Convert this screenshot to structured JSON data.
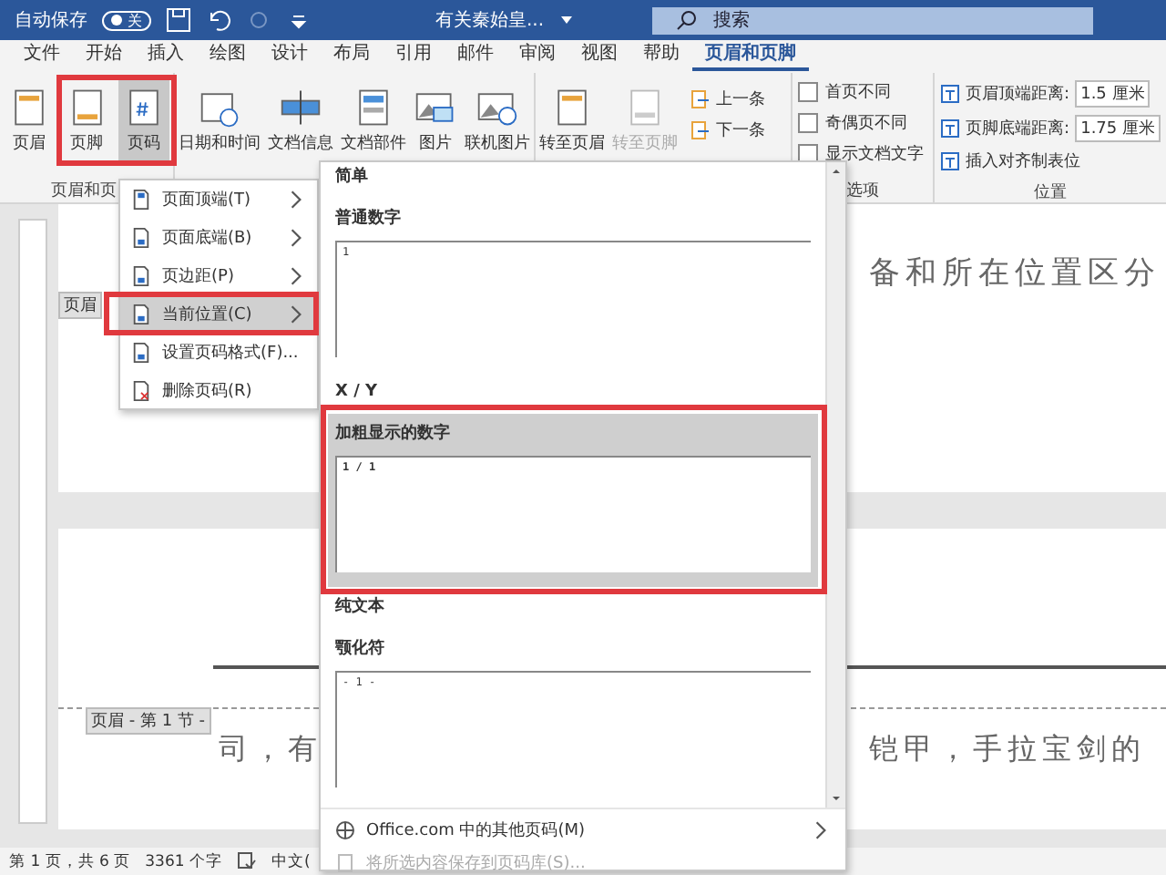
{
  "title_bar": {
    "autosave_label": "自动保存",
    "autosave_toggle": {
      "on": false,
      "label": "关"
    },
    "document_title": "有关秦始皇...",
    "search": {
      "placeholder": "搜索"
    }
  },
  "ribbon_tabs": [
    {
      "label": "文件",
      "selected": false
    },
    {
      "label": "开始",
      "selected": false
    },
    {
      "label": "插入",
      "selected": false
    },
    {
      "label": "绘图",
      "selected": false
    },
    {
      "label": "设计",
      "selected": false
    },
    {
      "label": "布局",
      "selected": false
    },
    {
      "label": "引用",
      "selected": false
    },
    {
      "label": "邮件",
      "selected": false
    },
    {
      "label": "审阅",
      "selected": false
    },
    {
      "label": "视图",
      "selected": false
    },
    {
      "label": "帮助",
      "selected": false
    },
    {
      "label": "页眉和页脚",
      "selected": true
    }
  ],
  "ribbon": {
    "header_footer_buttons": [
      {
        "label": "页眉",
        "kind": "header",
        "selected": false
      },
      {
        "label": "页脚",
        "kind": "footer",
        "selected": false
      },
      {
        "label": "页码",
        "kind": "page-number",
        "selected": true
      }
    ],
    "insert_buttons": [
      {
        "label": "日期和时间",
        "kind": "calendar"
      },
      {
        "label": "文档信息",
        "kind": "doc-info"
      },
      {
        "label": "文档部件",
        "kind": "doc-parts"
      },
      {
        "label": "图片",
        "kind": "picture"
      },
      {
        "label": "联机图片",
        "kind": "online-picture"
      }
    ],
    "navigation_buttons": [
      {
        "label": "转至页眉",
        "disabled": false
      },
      {
        "label": "转至页脚",
        "disabled": true
      }
    ],
    "small_nav": [
      {
        "label": "上一条"
      },
      {
        "label": "下一条"
      }
    ],
    "options": [
      {
        "label": "首页不同",
        "checked": false
      },
      {
        "label": "奇偶页不同",
        "checked": false
      },
      {
        "label": "显示文档文字",
        "checked": false
      }
    ],
    "position": [
      {
        "label": "页眉顶端距离:",
        "value": "1.5 厘米"
      },
      {
        "label": "页脚底端距离:",
        "value": "1.75 厘米"
      },
      {
        "label": "插入对齐制表位"
      }
    ],
    "group_labels": [
      "页眉和页",
      "选项",
      "位置"
    ]
  },
  "page_number_menu": [
    {
      "label": "页面顶端(T)",
      "submenu": true,
      "selected": false
    },
    {
      "label": "页面底端(B)",
      "submenu": true,
      "selected": false
    },
    {
      "label": "页边距(P)",
      "submenu": true,
      "selected": false
    },
    {
      "label": "当前位置(C)",
      "submenu": true,
      "selected": true
    },
    {
      "label": "设置页码格式(F)...",
      "submenu": false,
      "selected": false
    },
    {
      "label": "删除页码(R)",
      "submenu": false,
      "selected": false
    }
  ],
  "gallery": {
    "sections": [
      {
        "heading": "简单",
        "items": [
          {
            "label": "普通数字",
            "preview": "1",
            "selected": false
          }
        ]
      },
      {
        "heading": "X / Y",
        "items": [
          {
            "label": "加粗显示的数字",
            "preview": "1 / 1",
            "selected": true
          }
        ]
      },
      {
        "heading": "纯文本",
        "items": [
          {
            "label": "颚化符",
            "preview": "- 1 -",
            "selected": false
          }
        ]
      }
    ],
    "footer": [
      {
        "label": "Office.com 中的其他页码(M)",
        "disabled": false,
        "submenu": true
      },
      {
        "label": "将所选内容保存到页码库(S)...",
        "disabled": true,
        "submenu": false
      }
    ]
  },
  "document": {
    "page_1_tag": "页眉",
    "page_1_text": "备和所在位置区分",
    "page_2_tag": "页眉 - 第 1 节 -",
    "page_2_text_left": "司，有",
    "page_2_text_right": "铠甲，手拉宝剑的"
  },
  "status_bar": {
    "page": "第 1 页，共 6 页",
    "words": "3361 个字",
    "language": "中文("
  }
}
